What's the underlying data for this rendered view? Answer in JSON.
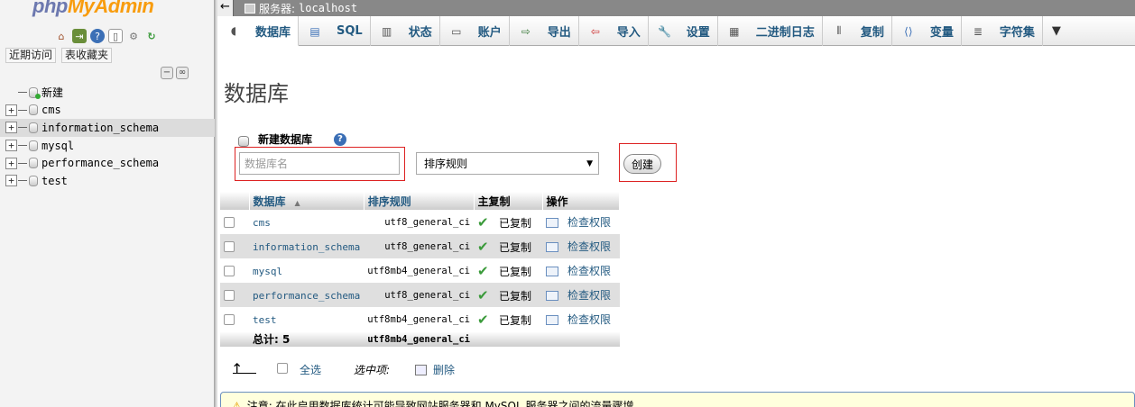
{
  "logo": {
    "php": "php",
    "my": "My",
    "admin": "Admin"
  },
  "nav": {
    "icons": [
      "home-icon",
      "exit-icon",
      "help-icon",
      "docs-icon",
      "settings-icon",
      "reload-icon"
    ],
    "recent_label": "近期访问",
    "favorites_label": "表收藏夹",
    "tree": [
      {
        "label": "新建"
      },
      {
        "label": "cms"
      },
      {
        "label": "information_schema"
      },
      {
        "label": "mysql"
      },
      {
        "label": "performance_schema"
      },
      {
        "label": "test"
      }
    ]
  },
  "topbar": {
    "server_label": "服务器:",
    "server_name": "localhost"
  },
  "menu": {
    "tabs": [
      {
        "label": "数据库",
        "icon": "database-icon"
      },
      {
        "label": "SQL",
        "icon": "sql-icon"
      },
      {
        "label": "状态",
        "icon": "status-icon"
      },
      {
        "label": "账户",
        "icon": "accounts-icon"
      },
      {
        "label": "导出",
        "icon": "export-icon"
      },
      {
        "label": "导入",
        "icon": "import-icon"
      },
      {
        "label": "设置",
        "icon": "settings-icon"
      },
      {
        "label": "二进制日志",
        "icon": "binlog-icon"
      },
      {
        "label": "复制",
        "icon": "replication-icon"
      },
      {
        "label": "变量",
        "icon": "variables-icon"
      },
      {
        "label": "字符集",
        "icon": "charset-icon"
      }
    ]
  },
  "main": {
    "title": "数据库",
    "create": {
      "legend": "新建数据库",
      "name_placeholder": "数据库名",
      "collation_value": "排序规则",
      "create_button": "创建"
    },
    "table": {
      "headers": {
        "database": "数据库",
        "collation": "排序规则",
        "replication": "主复制",
        "action": "操作"
      },
      "rows": [
        {
          "name": "cms",
          "collation": "utf8_general_ci",
          "replication": "已复制",
          "action": "检查权限"
        },
        {
          "name": "information_schema",
          "collation": "utf8_general_ci",
          "replication": "已复制",
          "action": "检查权限"
        },
        {
          "name": "mysql",
          "collation": "utf8mb4_general_ci",
          "replication": "已复制",
          "action": "检查权限"
        },
        {
          "name": "performance_schema",
          "collation": "utf8_general_ci",
          "replication": "已复制",
          "action": "检查权限"
        },
        {
          "name": "test",
          "collation": "utf8mb4_general_ci",
          "replication": "已复制",
          "action": "检查权限"
        }
      ],
      "total_label": "总计: 5",
      "total_collation": "utf8mb4_general_ci"
    },
    "bulk": {
      "check_all": "全选",
      "with_selected": "选中项:",
      "drop": "删除"
    },
    "notice": "注意: 在此启用数据库统计可能导致网站服务器和 MySQL 服务器之间的流量骤增。"
  }
}
